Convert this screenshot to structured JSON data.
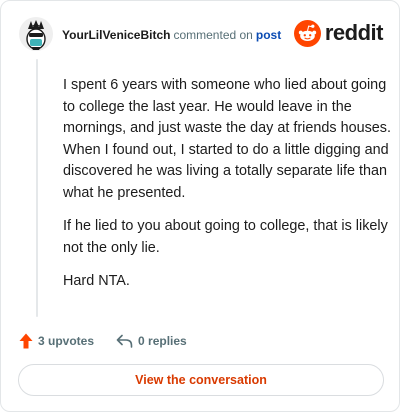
{
  "header": {
    "username": "YourLilVeniceBitch",
    "action_text": "commented on",
    "post_link": "post",
    "brand": "reddit"
  },
  "comment": {
    "paragraphs": [
      "I spent 6 years with someone who lied about going to college the last year. He would leave in the mornings, and just waste the day at friends houses. When I found out, I started to do a little digging and discovered he was living a totally separate life than what he presented.",
      "If he lied to you about going to college, that is likely not the only lie.",
      "Hard NTA."
    ]
  },
  "actions": {
    "upvotes": "3 upvotes",
    "replies": "0 replies"
  },
  "cta": {
    "label": "View the conversation"
  },
  "colors": {
    "upvote": "#ff4500",
    "brand": "#ff4500",
    "link": "#0a4bb3",
    "cta_text": "#d93a00",
    "meta": "#576f76"
  },
  "icons": [
    "user-avatar",
    "reddit-logo-icon",
    "upvote-arrow-icon",
    "reply-arrow-icon"
  ]
}
